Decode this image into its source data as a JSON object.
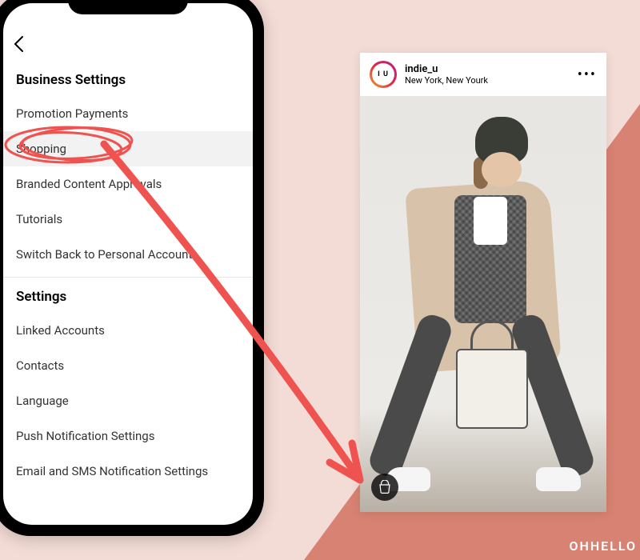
{
  "phone": {
    "sections": {
      "business": {
        "title": "Business Settings",
        "items": [
          "Promotion Payments",
          "Shopping",
          "Branded Content Approvals",
          "Tutorials",
          "Switch Back to Personal Account"
        ],
        "highlighted_index": 1
      },
      "general": {
        "title": "Settings",
        "items": [
          "Linked Accounts",
          "Contacts",
          "Language",
          "Push Notification Settings",
          "Email and SMS Notification Settings"
        ]
      }
    }
  },
  "post": {
    "avatar_initials": "I U",
    "username": "indie_u",
    "location": "New York, New Yourk",
    "more_label": "•••"
  },
  "annotation": {
    "circle_color": "#ef5350",
    "arrow_color": "#ef5350"
  },
  "watermark": "OHHELLO"
}
